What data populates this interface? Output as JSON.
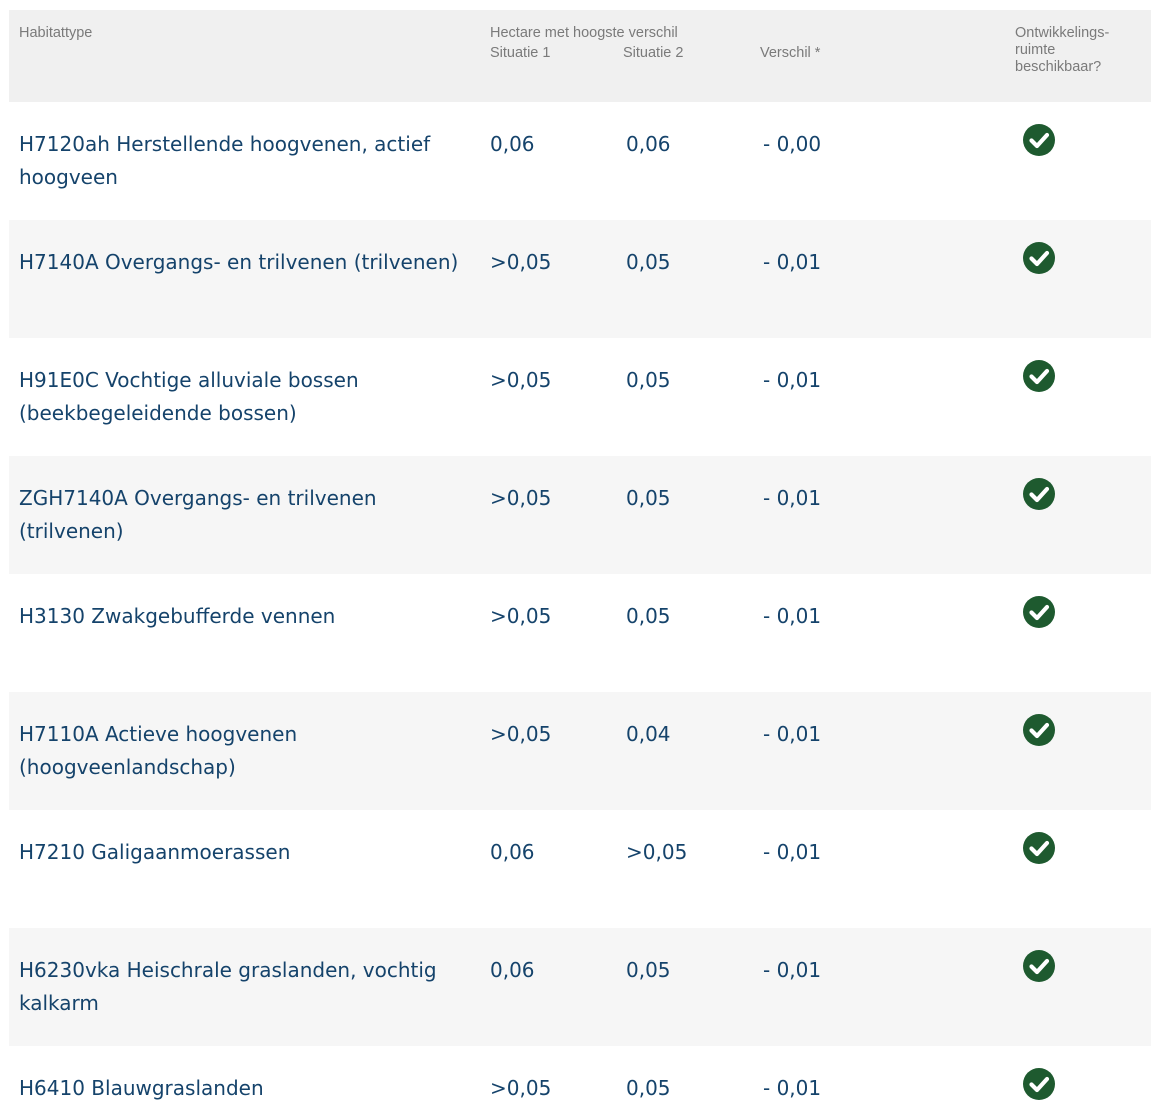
{
  "header": {
    "habitattype": "Habitattype",
    "hectare": "Hectare met hoogste verschil",
    "situatie1": "Situatie 1",
    "situatie2": "Situatie 2",
    "verschil": "Verschil *",
    "ontwikkelingsruimte": "Ontwikkelings-\nruimte\nbeschikbaar?"
  },
  "rows": [
    {
      "name": "H7120ah Herstellende hoogvenen, actief hoogveen",
      "situatie1": "0,06",
      "situatie2": "0,06",
      "verschil": "- 0,00",
      "status_icon": "check-circle-icon"
    },
    {
      "name": "H7140A Overgangs- en trilvenen (trilvenen)",
      "situatie1": ">0,05",
      "situatie2": "0,05",
      "verschil": "- 0,01",
      "status_icon": "check-circle-icon"
    },
    {
      "name": "H91E0C Vochtige alluviale bossen (beekbegeleidende bossen)",
      "situatie1": ">0,05",
      "situatie2": "0,05",
      "verschil": "- 0,01",
      "status_icon": "check-circle-icon"
    },
    {
      "name": "ZGH7140A Overgangs- en trilvenen (trilvenen)",
      "situatie1": ">0,05",
      "situatie2": "0,05",
      "verschil": "- 0,01",
      "status_icon": "check-circle-icon"
    },
    {
      "name": "H3130 Zwakgebufferde vennen",
      "situatie1": ">0,05",
      "situatie2": "0,05",
      "verschil": "- 0,01",
      "status_icon": "check-circle-icon"
    },
    {
      "name": "H7110A Actieve hoogvenen (hoogveenlandschap)",
      "situatie1": ">0,05",
      "situatie2": "0,04",
      "verschil": "- 0,01",
      "status_icon": "check-circle-icon"
    },
    {
      "name": "H7210 Galigaanmoerassen",
      "situatie1": "0,06",
      "situatie2": ">0,05",
      "verschil": "- 0,01",
      "status_icon": "check-circle-icon"
    },
    {
      "name": "H6230vka Heischrale graslanden, vochtig kalkarm",
      "situatie1": "0,06",
      "situatie2": "0,05",
      "verschil": "- 0,01",
      "status_icon": "check-circle-icon"
    },
    {
      "name": "H6410 Blauwgraslanden",
      "situatie1": ">0,05",
      "situatie2": "0,05",
      "verschil": "- 0,01",
      "status_icon": "check-circle-icon"
    }
  ],
  "colors": {
    "text": "#15436b",
    "header_text": "#7a7a7a",
    "header_bg": "#f0f0f0",
    "stripe_bg": "#f6f6f6",
    "check_icon": "#1e5a2f"
  }
}
